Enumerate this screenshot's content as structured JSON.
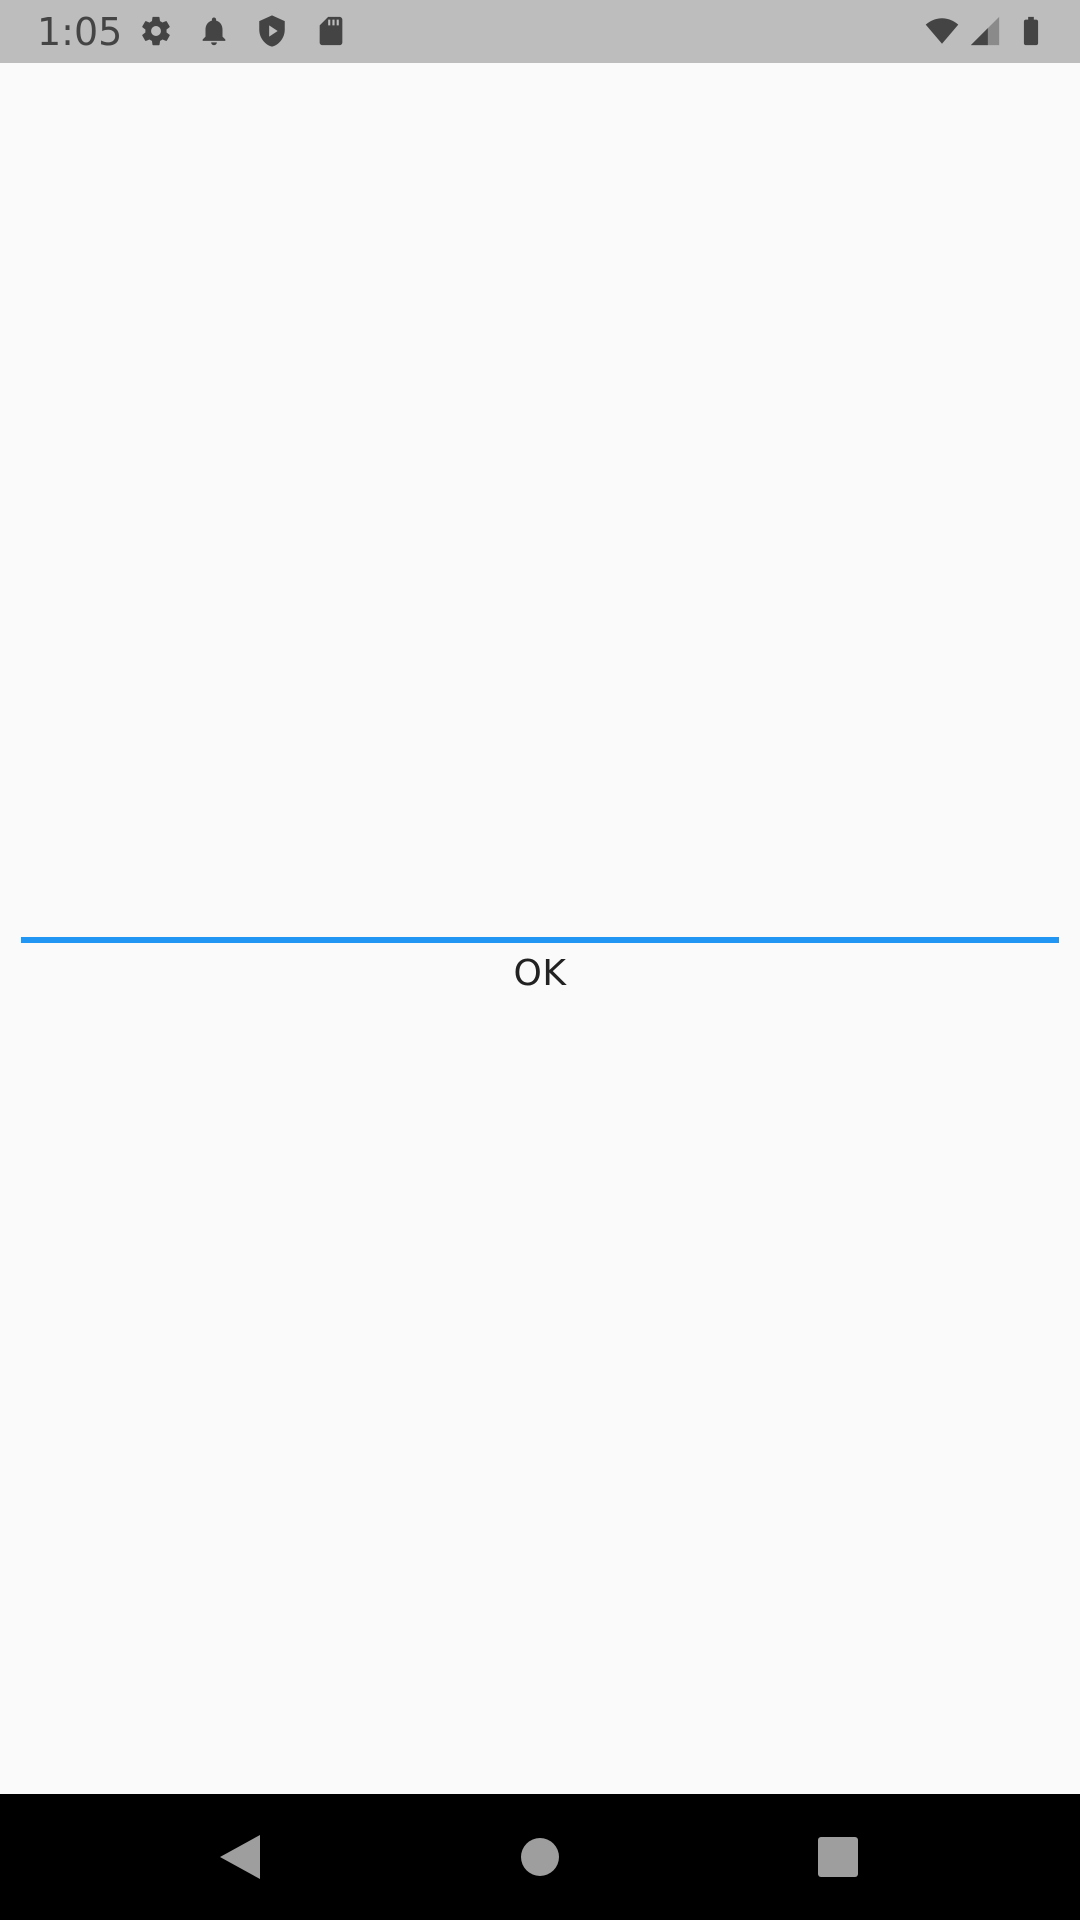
{
  "status_bar": {
    "time": "1:05",
    "left_icons": [
      "gear-icon",
      "bell-icon",
      "shield-play-icon",
      "sd-card-icon"
    ],
    "right_icons": [
      "wifi-icon",
      "signal-icon",
      "battery-icon"
    ],
    "background": "#bdbdbd",
    "icon_color": "#444444"
  },
  "main": {
    "accent_color": "#2196f3",
    "ok_button_label": "OK"
  },
  "nav_bar": {
    "buttons": [
      "back-icon",
      "home-icon",
      "recents-icon"
    ],
    "background": "#000000"
  }
}
